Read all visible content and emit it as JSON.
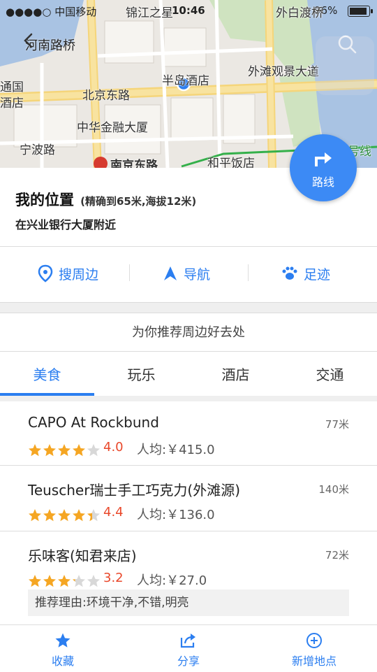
{
  "status_bar": {
    "carrier": "●●●●○ 中国移动",
    "time": "10:46",
    "battery": "96%",
    "battery_level": 0.96
  },
  "map": {
    "back_label": "河南路桥",
    "labels": {
      "top_street": "锦江之星",
      "top_right": "外白渡桥",
      "hotel": "半岛酒店",
      "bund": "外滩观景大道",
      "beijing_rd": "北京东路",
      "tongguo": "通国",
      "jiudian": "酒店",
      "zhonghua": "中华金融大厦",
      "ningbo": "宁波路",
      "nanjing": "南京东路",
      "heping": "和平饭店",
      "line2": "号线"
    },
    "route_button_label": "路线"
  },
  "location": {
    "title": "我的位置",
    "accuracy": "(精确到65米,海拔12米)",
    "near": "在兴业银行大厦附近"
  },
  "actions": [
    {
      "label": "搜周边",
      "icon": "location-pin-icon"
    },
    {
      "label": "导航",
      "icon": "navigation-arrow-icon"
    },
    {
      "label": "足迹",
      "icon": "footprint-icon"
    }
  ],
  "recommend_header": "为你推荐周边好去处",
  "tabs": [
    {
      "label": "美食",
      "active": true
    },
    {
      "label": "玩乐",
      "active": false
    },
    {
      "label": "酒店",
      "active": false
    },
    {
      "label": "交通",
      "active": false
    }
  ],
  "results": [
    {
      "name": "CAPO At Rockbund",
      "distance": "77米",
      "rating": 4.0,
      "score": "4.0",
      "price": "人均:￥415.0"
    },
    {
      "name": "Teuscher瑞士手工巧克力(外滩源)",
      "distance": "140米",
      "rating": 4.4,
      "score": "4.4",
      "price": "人均:￥136.0"
    },
    {
      "name": "乐味客(知君来店)",
      "distance": "72米",
      "rating": 3.2,
      "score": "3.2",
      "price": "人均:￥27.0",
      "reason": "推荐理由:环境干净,不错,明亮"
    }
  ],
  "bottom_bar": [
    {
      "label": "收藏",
      "icon": "star-icon"
    },
    {
      "label": "分享",
      "icon": "share-icon"
    },
    {
      "label": "新增地点",
      "icon": "add-circle-icon"
    }
  ],
  "colors": {
    "accent": "#2b7ef0",
    "route_button": "#3c8af5",
    "score": "#e9482b",
    "star": "#f5a623"
  }
}
